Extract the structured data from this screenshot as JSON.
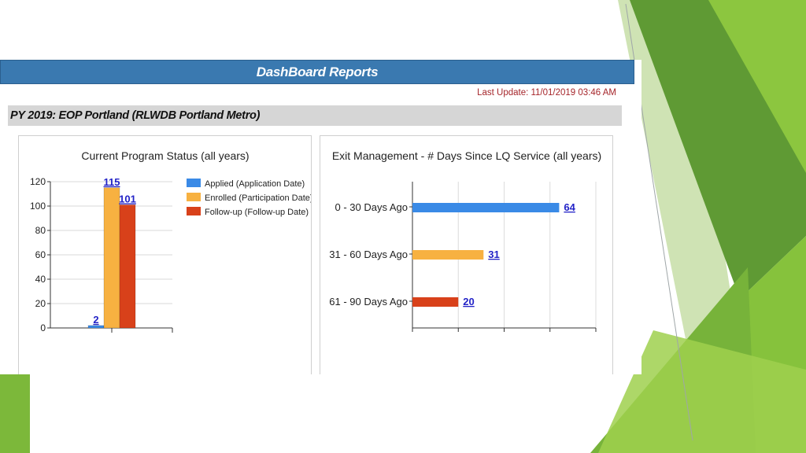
{
  "header": {
    "title": "DashBoard Reports"
  },
  "last_update": "Last Update: 11/01/2019 03:46 AM",
  "program": {
    "title": "PY 2019: EOP Portland  (RLWDB Portland Metro)"
  },
  "colors": {
    "header": "#3a79b0",
    "applied": "#3a8ae6",
    "enrolled": "#f7b141",
    "followup": "#d8411a",
    "deco_green": "#7cb83a"
  },
  "chart_data": [
    {
      "type": "bar",
      "title": "Current Program Status (all years)",
      "series": [
        {
          "name": "Applied (Application Date)",
          "values": [
            2
          ]
        },
        {
          "name": "Enrolled (Participation Date)",
          "values": [
            115
          ]
        },
        {
          "name": "Follow-up (Follow-up Date)",
          "values": [
            101
          ]
        }
      ],
      "data_labels": [
        "2",
        "115",
        "101"
      ],
      "yticks": [
        "0",
        "20",
        "40",
        "60",
        "80",
        "100",
        "120"
      ],
      "ylim": [
        0,
        120
      ],
      "legend": "right",
      "grid": true
    },
    {
      "type": "bar",
      "orientation": "horizontal",
      "title": "Exit Management - # Days Since LQ Service (all years)",
      "categories": [
        "0 - 30 Days Ago",
        "31 - 60 Days Ago",
        "61 - 90 Days Ago"
      ],
      "values": [
        64,
        31,
        20
      ],
      "data_labels": [
        "64",
        "31",
        "20"
      ],
      "xlim": [
        0,
        80
      ],
      "grid": true
    }
  ]
}
